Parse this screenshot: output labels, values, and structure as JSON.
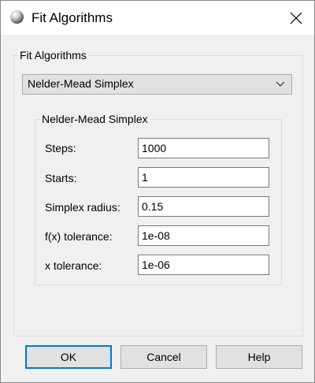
{
  "window": {
    "title": "Fit Algorithms"
  },
  "group": {
    "title": "Fit Algorithms",
    "algorithm_selected": "Nelder-Mead Simplex"
  },
  "params_group": {
    "title": "Nelder-Mead Simplex",
    "fields": [
      {
        "label": "Steps:",
        "value": "1000"
      },
      {
        "label": "Starts:",
        "value": "1"
      },
      {
        "label": "Simplex radius:",
        "value": "0.15"
      },
      {
        "label": "f(x) tolerance:",
        "value": "1e-08"
      },
      {
        "label": "x tolerance:",
        "value": "1e-06"
      }
    ]
  },
  "buttons": {
    "ok": "OK",
    "cancel": "Cancel",
    "help": "Help"
  },
  "colors": {
    "focus_border": "#0078d7",
    "dialog_bg": "#f0f0f0",
    "titlebar_bg": "#ffffff"
  },
  "icons": {
    "app": "sphere-icon",
    "close": "close-icon",
    "dropdown": "chevron-down-icon"
  }
}
